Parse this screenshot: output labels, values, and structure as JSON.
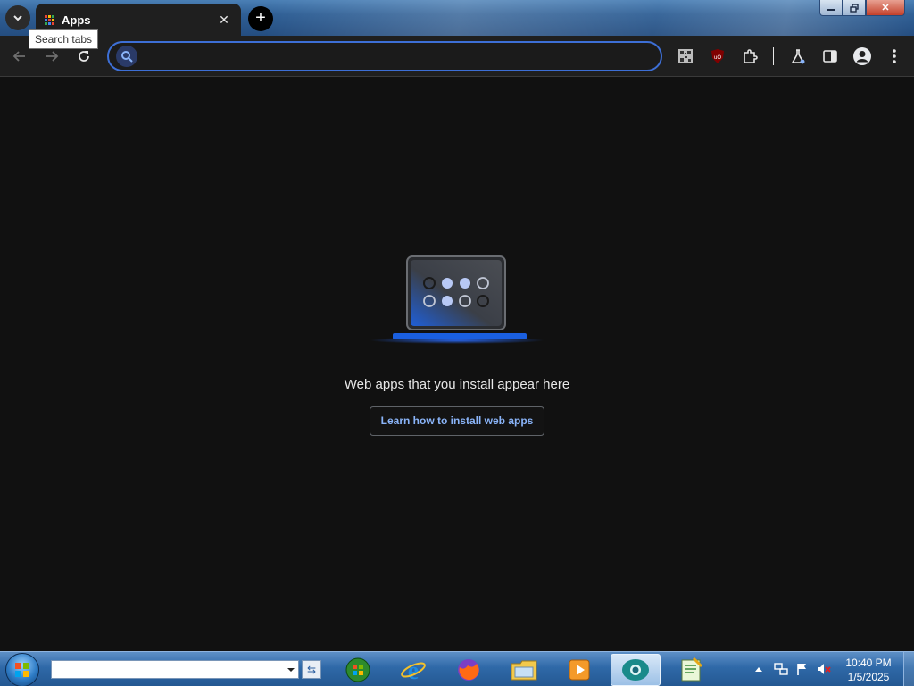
{
  "browser": {
    "tab_title": "Apps",
    "tooltip": "Search tabs",
    "omnibox_value": "",
    "omnibox_placeholder": ""
  },
  "content": {
    "empty_message": "Web apps that you install appear here",
    "learn_button": "Learn how to install web apps"
  },
  "taskbar": {
    "search_value": "",
    "clock_time": "10:40 PM",
    "clock_date": "1/5/2025",
    "pinned": [
      "windows-media-center-icon",
      "internet-explorer-icon",
      "firefox-icon",
      "file-explorer-icon",
      "media-player-icon",
      "chrome-icon",
      "notepad-icon"
    ]
  },
  "colors": {
    "accent": "#3d6fd6",
    "link": "#8ab4f8",
    "page_bg": "#111111",
    "toolbar_bg": "#1f1f1f"
  }
}
